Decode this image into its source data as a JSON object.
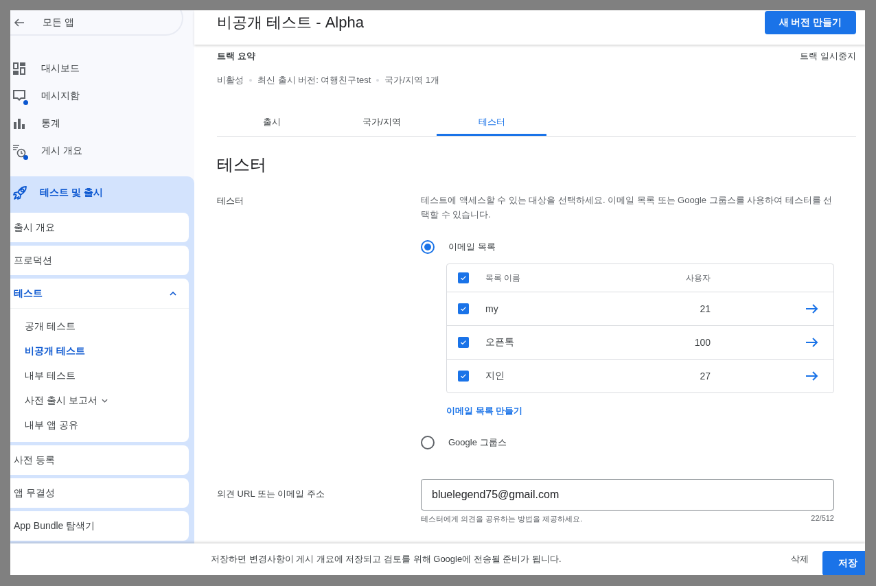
{
  "sidebar": {
    "back": "모든 앱",
    "nav": [
      {
        "label": "대시보드",
        "dot": false
      },
      {
        "label": "메시지함",
        "dot": true
      },
      {
        "label": "통계",
        "dot": false
      },
      {
        "label": "게시 개요",
        "dot": true
      }
    ],
    "section": {
      "label": "테스트 및 출시",
      "items": [
        {
          "label": "출시 개요",
          "kind": "link"
        },
        {
          "label": "프로덕션",
          "kind": "link"
        },
        {
          "label": "테스트",
          "kind": "group",
          "expanded": true,
          "children": [
            {
              "label": "공개 테스트",
              "kind": "link",
              "selected": false
            },
            {
              "label": "비공개 테스트",
              "kind": "link",
              "selected": true
            },
            {
              "label": "내부 테스트",
              "kind": "link",
              "selected": false
            },
            {
              "label": "사전 출시 보고서",
              "kind": "submenu",
              "selected": false
            },
            {
              "label": "내부 앱 공유",
              "kind": "link",
              "selected": false
            }
          ]
        },
        {
          "label": "사전 등록",
          "kind": "link"
        },
        {
          "label": "앱 무결성",
          "kind": "link"
        },
        {
          "label": "App Bundle 탐색기",
          "kind": "link"
        }
      ]
    }
  },
  "header": {
    "title": "비공개 테스트 - Alpha",
    "button": "새 버전 만들기"
  },
  "summary": {
    "title": "트랙 요약",
    "action": "트랙 일시중지",
    "meta": [
      "비활성",
      "최신 출시 버전: 여행친구test",
      "국가/지역 1개"
    ]
  },
  "tabs": [
    {
      "label": "출시",
      "selected": false
    },
    {
      "label": "국가/지역",
      "selected": false
    },
    {
      "label": "테스터",
      "selected": true
    }
  ],
  "section_title": "테스터",
  "testers": {
    "label": "테스터",
    "description": "테스트에 액세스할 수 있는 대상을 선택하세요. 이메일 목록 또는 Google 그룹스를 사용하여 테스터를 선택할 수 있습니다.",
    "options": [
      {
        "label": "이메일 목록",
        "selected": true
      },
      {
        "label": "Google 그룹스",
        "selected": false
      }
    ],
    "table": {
      "columns": [
        "목록 이름",
        "사용자"
      ],
      "all_checked": true,
      "rows": [
        {
          "name": "my",
          "users": "21",
          "checked": true
        },
        {
          "name": "오픈톡",
          "users": "100",
          "checked": true
        },
        {
          "name": "지인",
          "users": "27",
          "checked": true
        }
      ]
    },
    "create_link": "이메일 목록 만들기"
  },
  "feedback": {
    "label": "의견 URL 또는 이메일 주소",
    "value": "bluelegend75@gmail.com",
    "hint": "테스터에게 의견을 공유하는 방법을 제공하세요.",
    "counter": "22/512"
  },
  "footer": {
    "message": "저장하면 변경사항이 게시 개요에 저장되고 검토를 위해 Google에 전송될 준비가 됩니다.",
    "delete": "삭제",
    "save": "저장"
  }
}
